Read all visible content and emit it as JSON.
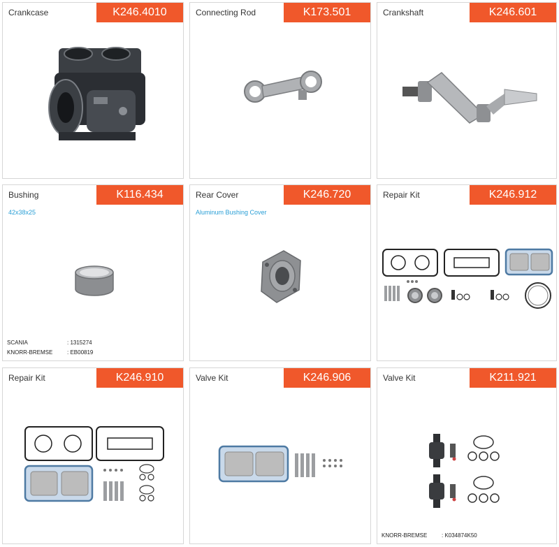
{
  "cards": [
    {
      "title": "Crankcase",
      "code": "K246.4010"
    },
    {
      "title": "Connecting Rod",
      "code": "K173.501"
    },
    {
      "title": "Crankshaft",
      "code": "K246.601"
    },
    {
      "title": "Bushing",
      "code": "K116.434",
      "subtitle": "42x38x25",
      "refs": [
        {
          "brand": "SCANIA",
          "number": ": 1315274"
        },
        {
          "brand": "KNORR-BREMSE",
          "number": ": EB00819"
        }
      ]
    },
    {
      "title": "Rear Cover",
      "code": "K246.720",
      "subtitle": "Aluminum Bushing Cover"
    },
    {
      "title": "Repair Kit",
      "code": "K246.912"
    },
    {
      "title": "Repair Kit",
      "code": "K246.910"
    },
    {
      "title": "Valve Kit",
      "code": "K246.906"
    },
    {
      "title": "Valve Kit",
      "code": "K211.921",
      "refs": [
        {
          "brand": "KNORR-BREMSE",
          "number": ": K034874K50"
        }
      ]
    }
  ],
  "icons": {
    "crankcase": "crankcase-image",
    "connecting_rod": "connecting-rod-image",
    "crankshaft": "crankshaft-image",
    "bushing": "bushing-image",
    "rear_cover": "rear-cover-image",
    "repair_kit": "repair-kit-image",
    "valve_kit": "valve-kit-image"
  },
  "colors": {
    "badge": "#f0582b",
    "subtitle": "#2a9fd6",
    "border": "#d6d6d6"
  }
}
